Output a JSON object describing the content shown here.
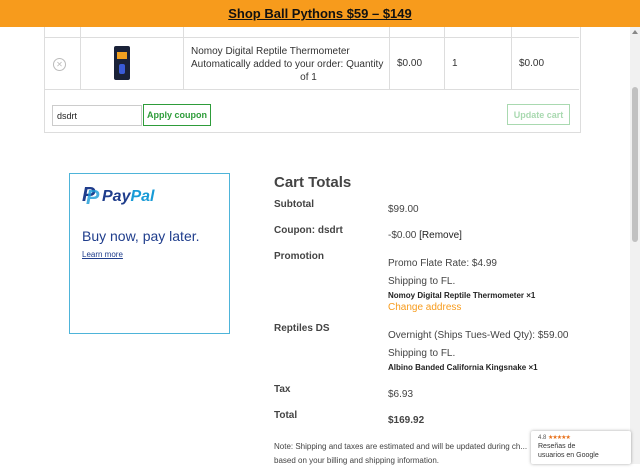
{
  "banner": {
    "text": "Shop Ball Pythons $59 – $149"
  },
  "cart": {
    "row": {
      "product": "Nomoy Digital Reptile Thermometer",
      "note": "Automatically added to your order: Quantity",
      "note_qty": "of 1",
      "price": "$0.00",
      "quantity": "1",
      "subtotal": "$0.00"
    },
    "coupon": {
      "value": "dsdrt",
      "apply_label": "Apply coupon"
    },
    "update_label": "Update cart"
  },
  "paypal": {
    "logo_pay": "Pay",
    "logo_pal": "Pal",
    "tagline": "Buy now, pay later.",
    "learn_more": "Learn more"
  },
  "totals": {
    "title": "Cart Totals",
    "subtotal_label": "Subtotal",
    "subtotal_value": "$99.00",
    "coupon_label": "Coupon: dsdrt",
    "coupon_value": "-$0.00",
    "coupon_remove": "[Remove]",
    "promotion_label": "Promotion",
    "promotion_rate": "Promo Flate Rate: $4.99",
    "promotion_shipping": "Shipping to FL.",
    "promotion_item": "Nomoy Digital Reptile Thermometer ×1",
    "change_address": "Change address",
    "reptiles_label": "Reptiles DS",
    "reptiles_rate": "Overnight (Ships Tues-Wed Qty): $59.00",
    "reptiles_shipping": "Shipping to FL.",
    "reptiles_item": "Albino Banded California Kingsnake ×1",
    "tax_label": "Tax",
    "tax_value": "$6.93",
    "total_label": "Total",
    "total_value": "$169.92",
    "note": "Note: Shipping and taxes are estimated and will be updated during ch... based on your billing and shipping information."
  },
  "reviews_widget": {
    "rating": "4.8",
    "stars": "★★★★★",
    "line1": "Reseñas de",
    "line2": "usuarios en Google"
  },
  "colors": {
    "accent": "#f79b1c",
    "button_green": "#2e9c3a",
    "paypal_blue": "#1f3d8c"
  }
}
